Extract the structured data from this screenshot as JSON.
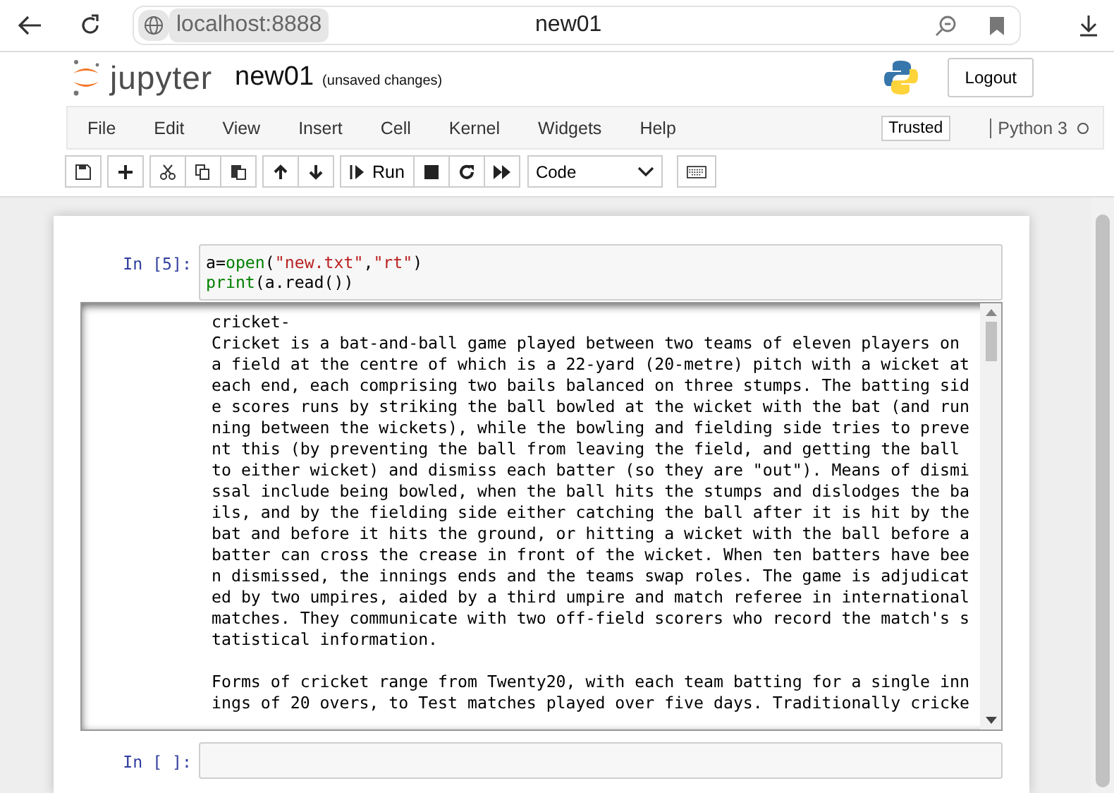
{
  "browser": {
    "url": "localhost:8888",
    "tab_title": "new01"
  },
  "header": {
    "logo_text": "jupyter",
    "notebook_name": "new01",
    "save_status": "(unsaved changes)",
    "logout": "Logout"
  },
  "menu": [
    "File",
    "Edit",
    "View",
    "Insert",
    "Cell",
    "Kernel",
    "Widgets",
    "Help"
  ],
  "trusted": "Trusted",
  "kernel": {
    "name": "Python 3",
    "busy": false
  },
  "toolbar": [
    [
      {
        "kind": "save"
      }
    ],
    [
      {
        "kind": "add"
      }
    ],
    [
      {
        "kind": "cut"
      },
      {
        "kind": "copy"
      },
      {
        "kind": "paste"
      }
    ],
    [
      {
        "kind": "up"
      },
      {
        "kind": "down"
      }
    ],
    [
      {
        "kind": "run",
        "label": "Run"
      },
      {
        "kind": "stop"
      },
      {
        "kind": "restart"
      },
      {
        "kind": "run-all"
      }
    ]
  ],
  "cell_type": "Code",
  "command_palette": {
    "kind": "keyboard"
  },
  "cells": [
    {
      "prompt": "In [5]:",
      "code": [
        [
          {
            "text": "a=",
            "kind": "plain"
          },
          {
            "text": "open",
            "kind": "builtin"
          },
          {
            "text": "(",
            "kind": "plain"
          },
          {
            "text": "\"new.txt\"",
            "kind": "string"
          },
          {
            "text": ",",
            "kind": "plain"
          },
          {
            "text": "\"rt\"",
            "kind": "string"
          },
          {
            "text": ")",
            "kind": "plain"
          }
        ],
        [
          {
            "text": "print",
            "kind": "builtin"
          },
          {
            "text": "(a.read())",
            "kind": "plain"
          }
        ]
      ],
      "output": [
        [
          "cricket-",
          "Cricket is a bat-and-ball game played between two teams of eleven players on",
          "a field at the centre of which is a 22-yard (20-metre) pitch with a wicket at",
          "each end, each comprising two bails balanced on three stumps. The batting sid",
          "e scores runs by striking the ball bowled at the wicket with the bat (and run",
          "ning between the wickets), while the bowling and fielding side tries to preve",
          "nt this (by preventing the ball from leaving the field, and getting the ball",
          "to either wicket) and dismiss each batter (so they are \"out\"). Means of dismi",
          "ssal include being bowled, when the ball hits the stumps and dislodges the ba",
          "ils, and by the fielding side either catching the ball after it is hit by the",
          "bat and before it hits the ground, or hitting a wicket with the ball before a",
          "batter can cross the crease in front of the wicket. When ten batters have bee",
          "n dismissed, the innings ends and the teams swap roles. The game is adjudicat",
          "ed by two umpires, aided by a third umpire and match referee in international",
          "matches. They communicate with two off-field scorers who record the match's s",
          "tatistical information."
        ],
        [
          "Forms of cricket range from Twenty20, with each team batting for a single inn",
          "ings of 20 overs, to Test matches played over five days. Traditionally cricke"
        ]
      ]
    },
    {
      "prompt": "In [ ]:"
    }
  ]
}
